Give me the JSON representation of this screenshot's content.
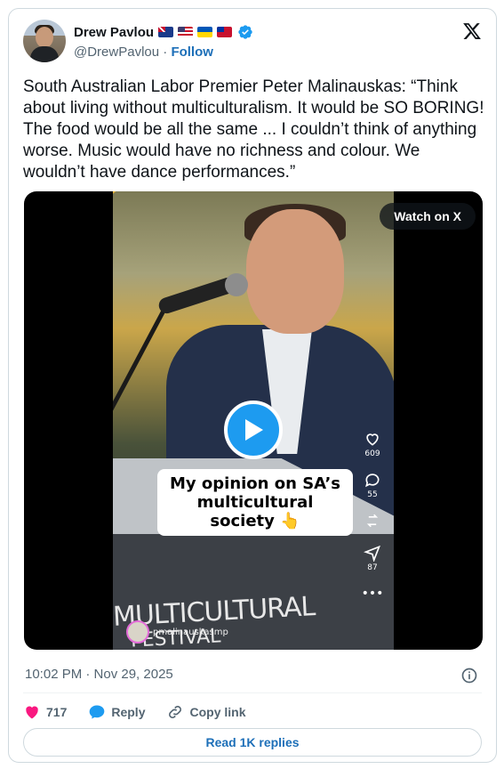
{
  "author": {
    "name": "Drew Pavlou",
    "handle": "@DrewPavlou",
    "follow_label": "Follow",
    "flags": [
      "australia",
      "united-states",
      "ukraine",
      "taiwan"
    ]
  },
  "tweet": {
    "text": "South Australian Labor Premier Peter Malinauskas: “Think about living without multiculturalism. It would be SO BORING! The food would be all the same ... I couldn’t think of anything worse. Music would have no richness and colour. We wouldn’t have dance performances.”",
    "timestamp": "10:02 PM · Nov 29, 2025"
  },
  "media": {
    "watch_label": "Watch on X",
    "caption": "My opinion on SA’s multicultural society 👆",
    "uploader": "pmalinauskasmp",
    "banner_line1": "MULTICULTURAL",
    "banner_line2": "FESTIVAL",
    "side_counts": {
      "likes": "609",
      "comments": "55",
      "shares": "87"
    }
  },
  "actions": {
    "like_count": "717",
    "reply_label": "Reply",
    "copy_link_label": "Copy link",
    "read_replies_label": "Read 1K replies"
  },
  "colors": {
    "accent": "#1d9bf0",
    "like": "#f91880",
    "link": "#1d6fb8",
    "muted": "#536471"
  }
}
